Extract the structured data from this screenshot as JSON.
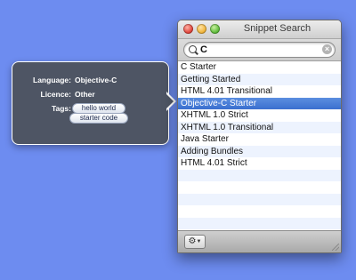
{
  "window": {
    "title": "Snippet Search"
  },
  "search": {
    "value": "C"
  },
  "snippets": [
    "C Starter",
    "Getting Started",
    "HTML 4.01 Transitional",
    "Objective-C Starter",
    "XHTML 1.0 Strict",
    "XHTML 1.0 Transitional",
    "Java Starter",
    "Adding Bundles",
    "HTML 4.01 Strict"
  ],
  "selected_index": 3,
  "info": {
    "language_label": "Language:",
    "language_value": "Objective-C",
    "licence_label": "Licence:",
    "licence_value": "Other",
    "tags_label": "Tags:",
    "tags": [
      "hello world",
      "starter code"
    ]
  },
  "icons": {
    "search": "search-icon",
    "clear": "clear-search-icon",
    "action": "gear-icon",
    "resize": "resize-grip-icon"
  },
  "colors": {
    "desktop": "#6d8cf0",
    "selection": "#3a6fcf",
    "hud": "#4e5564"
  }
}
